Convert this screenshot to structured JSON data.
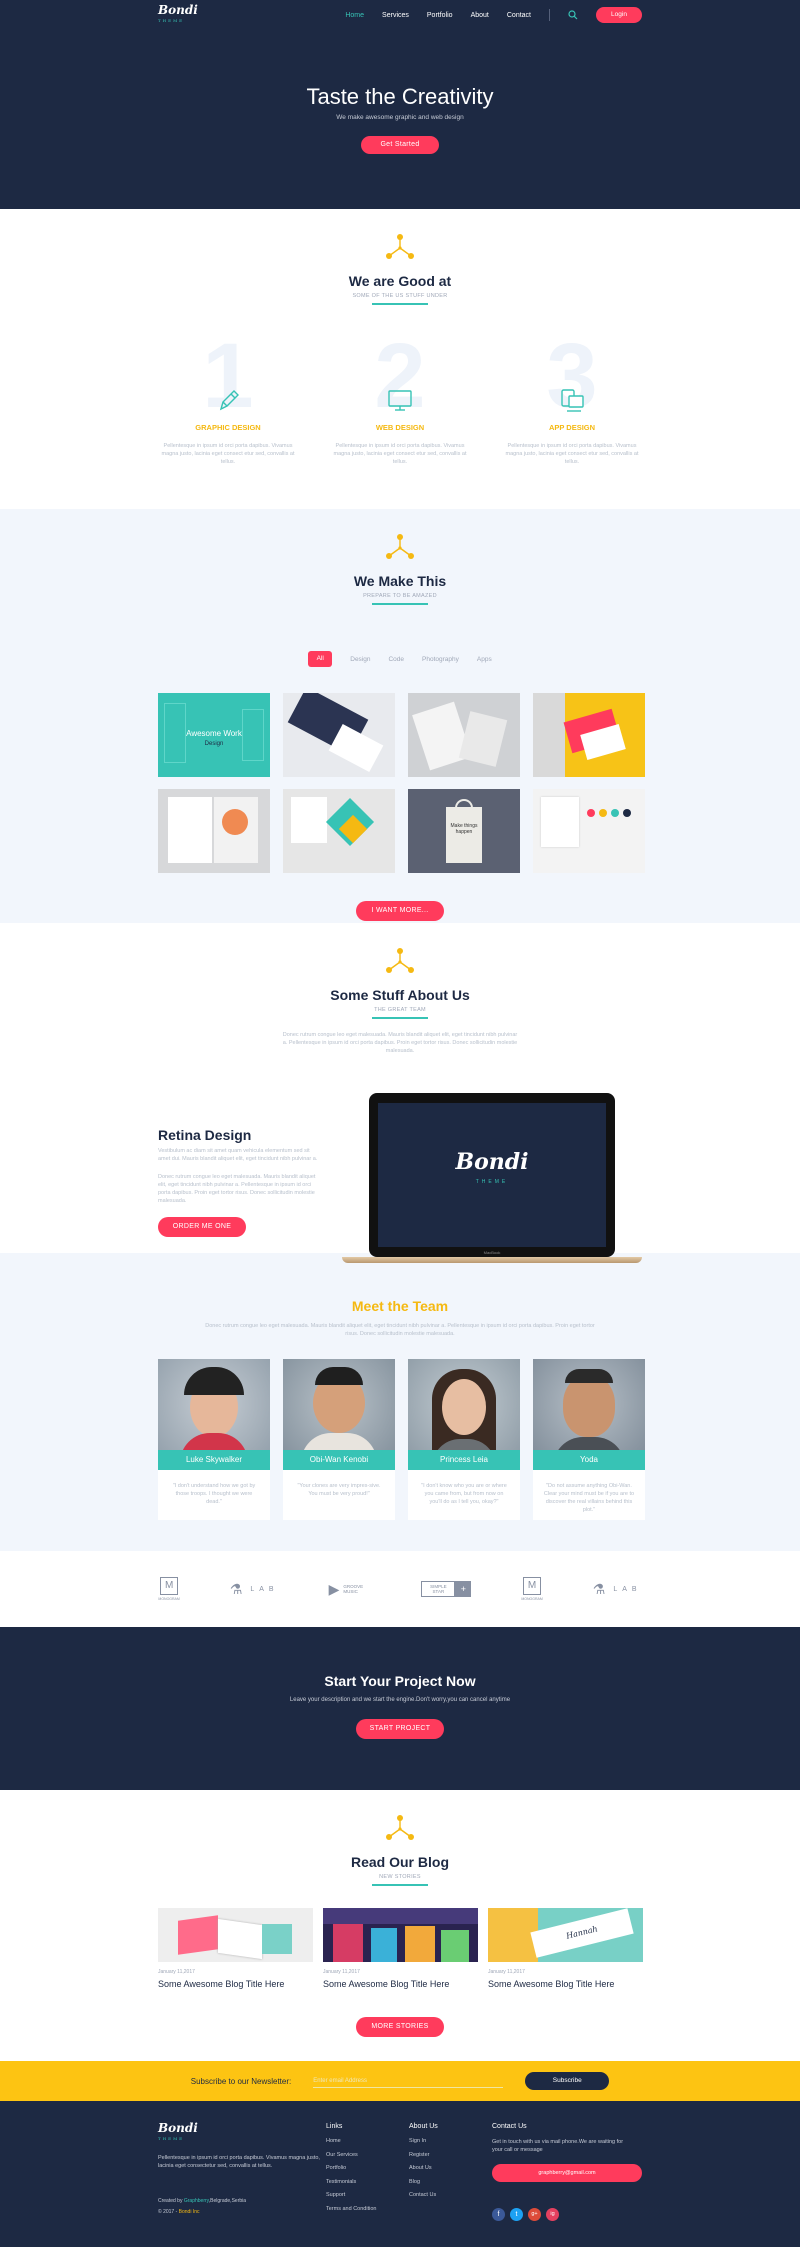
{
  "brand": {
    "name": "Bondi",
    "tag": "THEME"
  },
  "nav": {
    "items": [
      "Home",
      "Services",
      "Portfolio",
      "About",
      "Contact"
    ],
    "login": "Login"
  },
  "hero": {
    "title": "Taste the Creativity",
    "subtitle": "We make awesome graphic and web design",
    "cta": "Get Started"
  },
  "good": {
    "title": "We are Good at",
    "subtitle": "SOME OF THE US STUFF UNDER",
    "items": [
      {
        "num": "1",
        "title": "GRAPHIC DESIGN",
        "text": "Pellentesque in ipsum id orci porta dapibus. Vivamus magna justo, lacinia eget consect etur sed, convallis at tellus."
      },
      {
        "num": "2",
        "title": "WEB DESIGN",
        "text": "Pellentesque in ipsum id orci porta dapibus. Vivamus magna justo, lacinia eget consect etur sed, convallis at tellus."
      },
      {
        "num": "3",
        "title": "APP DESIGN",
        "text": "Pellentesque in ipsum id orci porta dapibus. Vivamus magna justo, lacinia eget consect etur sed, convallis at tellus."
      }
    ]
  },
  "make": {
    "title": "We Make This",
    "subtitle": "PREPARE TO BE AMAZED",
    "filters": [
      "All",
      "Design",
      "Code",
      "Photography",
      "Apps"
    ],
    "first_tile": {
      "title": "Awesome Work",
      "tag": "Design"
    },
    "bag_text": "Make things happen",
    "more": "I WANT MORE..."
  },
  "about": {
    "title": "Some Stuff About Us",
    "subtitle": "THE GREAT TEAM",
    "intro": "Donec rutrum congue leo eget malesuada. Mauris blandit aliquet elit, eget tincidunt nibh pulvinar a. Pellentesque in ipsum id orci porta dapibus. Proin eget tortor risus. Donec sollicitudin molestie malesuada.",
    "retina_title": "Retina Design",
    "p1": "Vestibulum ac diam sit amet quam vehicula elementum sed sit amet dui. Mauris blandit aliquet elit, eget tincidunt nibh pulvinar a.",
    "p2": "Donec rutrum congue leo eget malesuada. Mauris blandit aliquet elit, eget tincidunt nibh pulvinar a. Pellentesque in ipsum id orci porta dapibus. Proin eget tortor risus. Donec sollicitudin molestie malesuada.",
    "cta": "ORDER ME ONE",
    "laptop_label": "MacBook"
  },
  "team": {
    "title": "Meet the Team",
    "intro": "Donec rutrum congue leo eget malesuada. Mauris blandit aliquet elit, eget tincidunt nibh pulvinar a. Pellentesque in ipsum id orci porta dapibus. Proin eget tortor risus. Donec sollicitudin molestie malesuada.",
    "members": [
      {
        "name": "Luke Skywalker",
        "quote": "\"I don't understand how we got by those troops. I thought we were dead.\""
      },
      {
        "name": "Obi-Wan Kenobi",
        "quote": "\"Your clones are very impres-sive. You must be very proud!\""
      },
      {
        "name": "Princess Leia",
        "quote": "\"I don't know who you are or where you came from, but from now on you'll do as I tell you, okay?\""
      },
      {
        "name": "Yoda",
        "quote": "\"Do not assume anything Obi-Wan. Clear your mind must be if you are to discover the real villains behind this plot.\""
      }
    ]
  },
  "logos": [
    {
      "mark": "M",
      "name": "MONOGRAM"
    },
    {
      "mark": "⚗",
      "name": "LAB"
    },
    {
      "mark": "▶",
      "name": "GROOVE MUSIC"
    },
    {
      "mark": "SIMPLE STAR",
      "name": "+"
    },
    {
      "mark": "M",
      "name": "MONOGRAM"
    },
    {
      "mark": "⚗",
      "name": "LAB"
    }
  ],
  "start": {
    "title": "Start Your Project Now",
    "subtitle": "Leave your description and we start the engine.Don't worry,you can cancel anytime",
    "cta": "START PROJECT"
  },
  "blog": {
    "title": "Read Our Blog",
    "subtitle": "NEW STORIES",
    "posts": [
      {
        "date": "January 11,2017",
        "title": "Some Awesome Blog Title Here"
      },
      {
        "date": "January 11,2017",
        "title": "Some Awesome Blog Title Here"
      },
      {
        "date": "January 11,2017",
        "title": "Some Awesome Blog Title Here"
      }
    ],
    "card_word": "Hannah",
    "more": "MORE STORIES"
  },
  "newsletter": {
    "label": "Subscribe to our Newsletter:",
    "placeholder": "Enter email Address",
    "button": "Subscribe"
  },
  "footer": {
    "about": "Pellentesque in ipsum id orci porta dapibus. Vivamus magna justo, lacinia eget consectetur sed, convallis at tellus.",
    "created_prefix": "Created by ",
    "created_link": "Graphberry",
    "created_suffix": ",Belgrade,Serbia",
    "copy_prefix": "© 2017 - ",
    "copy_link": "Bondi Inc",
    "links_title": "Links",
    "links": [
      "Home",
      "Our Services",
      "Portfolio",
      "Testimonials",
      "Support",
      "Terms and Condition"
    ],
    "about_title": "About Us",
    "about_links": [
      "Sign In",
      "Register",
      "About Us",
      "Blog",
      "Contact Us"
    ],
    "contact_title": "Contact Us",
    "contact_text": "Get in touch with us via mail phone.We are waiting for your call or message",
    "email": "graphberry@gmail.com",
    "social": [
      "f",
      "t",
      "g+",
      "ig"
    ],
    "colors": {
      "facebook": "#3b5998",
      "twitter": "#1da1f2",
      "google": "#dd4b39",
      "instagram": "#e4405f"
    }
  },
  "colors": {
    "navy": "#1d2943",
    "accent": "#ff3b5c",
    "teal": "#37c3b5",
    "yellow": "#fdc412"
  }
}
